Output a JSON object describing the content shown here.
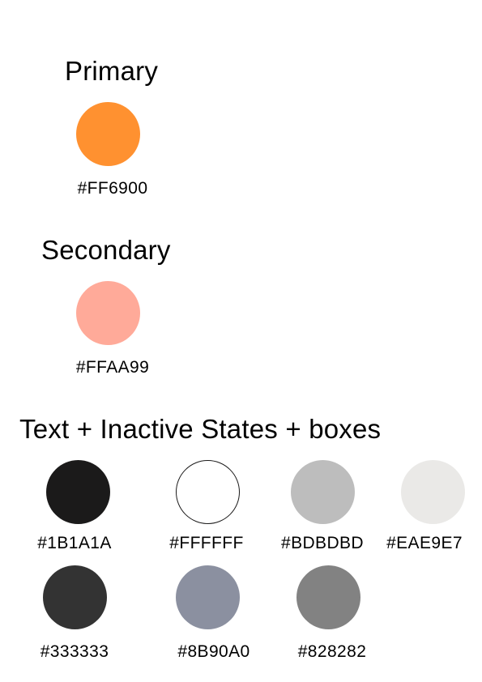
{
  "sections": {
    "primary": {
      "title": "Primary",
      "colors": [
        {
          "label": "#FF6900",
          "color": "#FF9130"
        }
      ]
    },
    "secondary": {
      "title": "Secondary",
      "colors": [
        {
          "label": "#FFAA99",
          "color": "#FFAA99"
        }
      ]
    },
    "text_states": {
      "title": "Text + Inactive States + boxes",
      "colors": [
        {
          "label": "#1B1A1A",
          "color": "#1B1A1A"
        },
        {
          "label": "#FFFFFF",
          "color": "#FFFFFF"
        },
        {
          "label": "#BDBDBD",
          "color": "#BDBDBD"
        },
        {
          "label": "#EAE9E7",
          "color": "#EAE9E7"
        },
        {
          "label": "#333333",
          "color": "#333333"
        },
        {
          "label": "#8B90A0",
          "color": "#8B90A0"
        },
        {
          "label": "#828282",
          "color": "#828282"
        }
      ]
    }
  }
}
